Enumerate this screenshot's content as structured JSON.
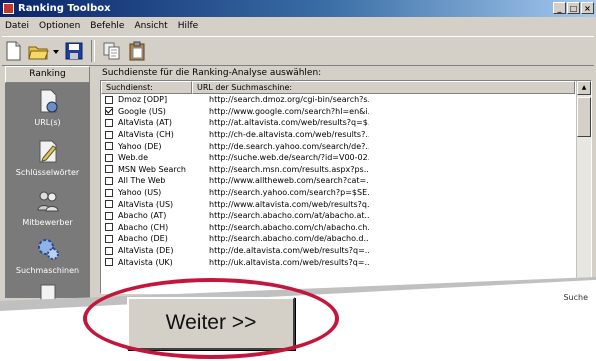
{
  "window": {
    "title": "Ranking Toolbox",
    "controls": [
      "_",
      "□",
      "×"
    ]
  },
  "menu": [
    "Datei",
    "Optionen",
    "Befehle",
    "Ansicht",
    "Hilfe"
  ],
  "sidebar": {
    "header": "Ranking",
    "items": [
      {
        "label": "URL(s)",
        "icon": "url-page-icon"
      },
      {
        "label": "Schlüsselwörter",
        "icon": "keywords-pen-icon"
      },
      {
        "label": "Mitbewerber",
        "icon": "competitors-people-icon"
      },
      {
        "label": "Suchmaschinen",
        "icon": "search-engines-gears-icon"
      }
    ]
  },
  "main": {
    "instruction": "Suchdienste für die Ranking-Analyse auswählen:",
    "columns": [
      "Suchdienst:",
      "URL der Suchmaschine:"
    ],
    "rows": [
      {
        "checked": false,
        "service": "Dmoz [ODP]",
        "url": "http://search.dmoz.org/cgi-bin/search?s..."
      },
      {
        "checked": true,
        "service": "Google (US)",
        "url": "http://www.google.com/search?hl=en&i..."
      },
      {
        "checked": false,
        "service": "AltaVista (AT)",
        "url": "http://at.altavista.com/web/results?q=$..."
      },
      {
        "checked": false,
        "service": "AltaVista (CH)",
        "url": "http://ch-de.altavista.com/web/results?..."
      },
      {
        "checked": false,
        "service": "Yahoo (DE)",
        "url": "http://de.search.yahoo.com/search/de?..."
      },
      {
        "checked": false,
        "service": "Web.de",
        "url": "http://suche.web.de/search/?id=V00-02..."
      },
      {
        "checked": false,
        "service": "MSN Web Search",
        "url": "http://search.msn.com/results.aspx?ps..."
      },
      {
        "checked": false,
        "service": "All The Web",
        "url": "http://www.alltheweb.com/search?cat=..."
      },
      {
        "checked": false,
        "service": "Yahoo (US)",
        "url": "http://search.yahoo.com/search?p=$SE..."
      },
      {
        "checked": false,
        "service": "AltaVista (US)",
        "url": "http://www.altavista.com/web/results?q..."
      },
      {
        "checked": false,
        "service": "Abacho (AT)",
        "url": "http://search.abacho.com/at/abacho.at..."
      },
      {
        "checked": false,
        "service": "Abacho (CH)",
        "url": "http://search.abacho.com/ch/abacho.ch..."
      },
      {
        "checked": false,
        "service": "Abacho (DE)",
        "url": "http://search.abacho.com/de/abacho.d..."
      },
      {
        "checked": false,
        "service": "AltaVista (DE)",
        "url": "http://de.altavista.com/web/results?q=..."
      },
      {
        "checked": false,
        "service": "Altavista (UK)",
        "url": "http://uk.altavista.com/web/results?q=..."
      }
    ]
  },
  "status": "Suche",
  "next_button": "Weiter >>",
  "highlight_color": "#c4163c"
}
